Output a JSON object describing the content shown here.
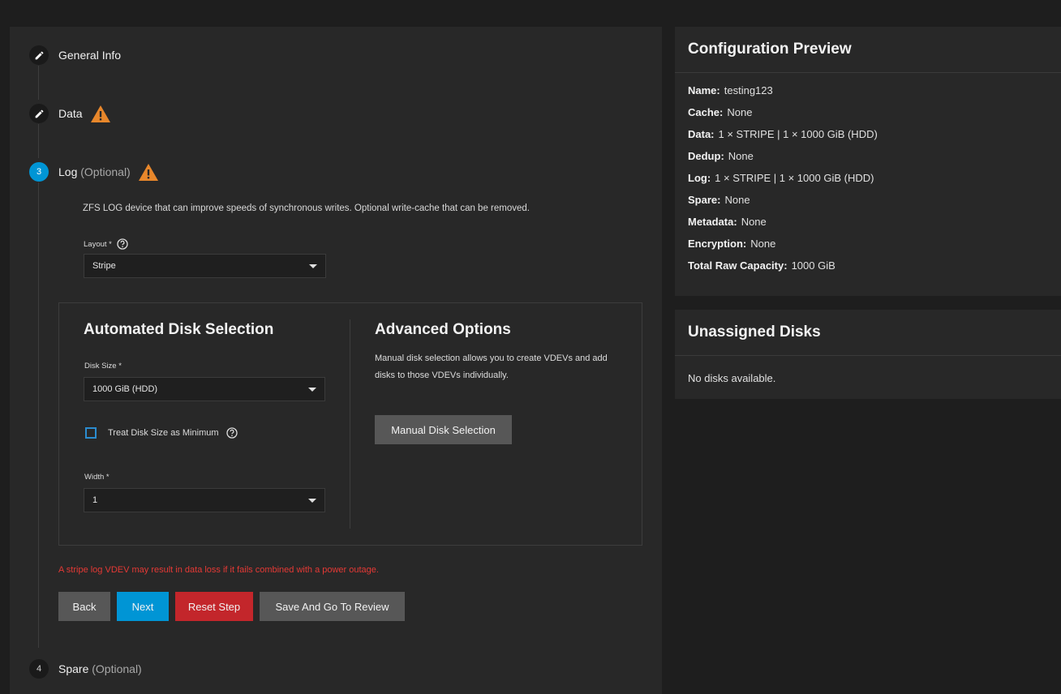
{
  "steps": [
    {
      "label": "General Info",
      "optional": "",
      "state": "done"
    },
    {
      "label": "Data",
      "optional": "",
      "state": "done"
    },
    {
      "label": "Log",
      "optional": "(Optional)",
      "state": "active",
      "number": "3"
    },
    {
      "label": "Spare",
      "optional": "(Optional)",
      "state": "pending",
      "number": "4"
    }
  ],
  "log": {
    "description": "ZFS LOG device that can improve speeds of synchronous writes. Optional write-cache that can be removed.",
    "layout_label": "Layout *",
    "layout_value": "Stripe",
    "automated": {
      "title": "Automated Disk Selection",
      "disk_size_label": "Disk Size *",
      "disk_size_value": "1000 GiB (HDD)",
      "treat_min_label": "Treat Disk Size as Minimum",
      "width_label": "Width *",
      "width_value": "1"
    },
    "advanced": {
      "title": "Advanced Options",
      "text": "Manual disk selection allows you to create VDEVs and add disks to those VDEVs individually.",
      "button": "Manual Disk Selection"
    },
    "error": "A stripe log VDEV may result in data loss if it fails combined with a power outage."
  },
  "buttons": {
    "back": "Back",
    "next": "Next",
    "reset": "Reset Step",
    "save_review": "Save And Go To Review"
  },
  "preview": {
    "title": "Configuration Preview",
    "rows": [
      {
        "key": "Name:",
        "value": "testing123"
      },
      {
        "key": "Cache:",
        "value": "None"
      },
      {
        "key": "Data:",
        "value": "1 × STRIPE | 1 × 1000 GiB (HDD)"
      },
      {
        "key": "Dedup:",
        "value": "None"
      },
      {
        "key": "Log:",
        "value": "1 × STRIPE | 1 × 1000 GiB (HDD)"
      },
      {
        "key": "Spare:",
        "value": "None"
      },
      {
        "key": "Metadata:",
        "value": "None"
      },
      {
        "key": "Encryption:",
        "value": "None"
      },
      {
        "key": "Total Raw Capacity:",
        "value": "1000 GiB"
      }
    ]
  },
  "unassigned": {
    "title": "Unassigned Disks",
    "text": "No disks available."
  },
  "colors": {
    "accent": "#0095d5",
    "warning": "#e8872b",
    "danger": "#c3262b"
  }
}
